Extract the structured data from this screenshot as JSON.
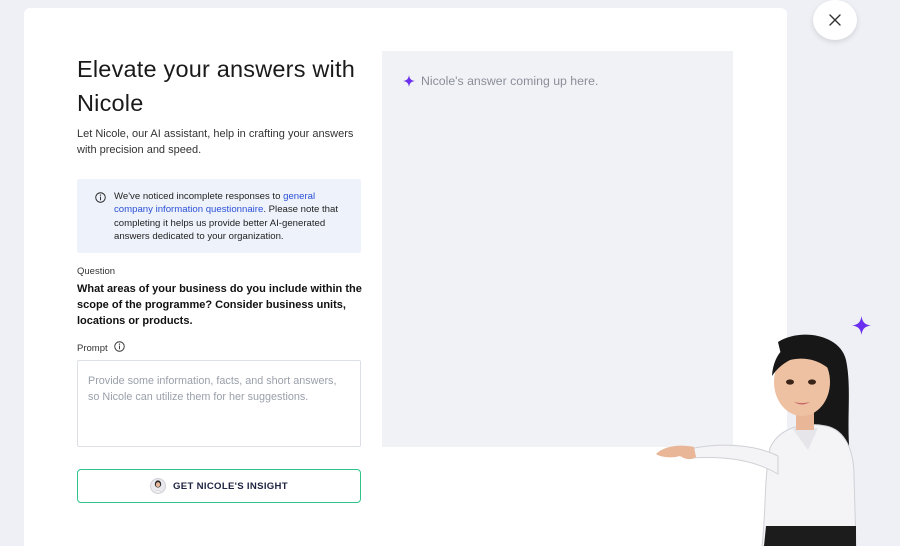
{
  "modal": {
    "title": "Elevate your answers with Nicole",
    "subtitle": "Let Nicole, our AI assistant, help in crafting your answers with precision and speed."
  },
  "notice": {
    "text_before": "We've noticed incomplete responses to ",
    "link_text": "general company information questionnaire",
    "text_after": ". Please note that completing it helps us provide better AI-generated answers dedicated to your organization."
  },
  "question": {
    "label": "Question",
    "text": "What areas of your business do you include within the scope of the programme? Consider business units, locations or products."
  },
  "prompt": {
    "label": "Prompt",
    "placeholder": "Provide some information, facts, and short answers, so Nicole can utilize them for her suggestions.",
    "value": ""
  },
  "cta": {
    "label": "GET NICOLE'S INSIGHT"
  },
  "answer": {
    "placeholder": "Nicole's answer coming up here."
  },
  "icons": {
    "close": "close-icon",
    "info": "info-icon",
    "sparkle": "sparkle-icon",
    "avatar": "nicole-avatar"
  },
  "colors": {
    "accent_purple": "#6a2ff0",
    "cta_border": "#2ec48a",
    "link": "#2a4fd6",
    "notice_bg": "#eef3fb",
    "panel_bg": "#f1f2f6"
  }
}
